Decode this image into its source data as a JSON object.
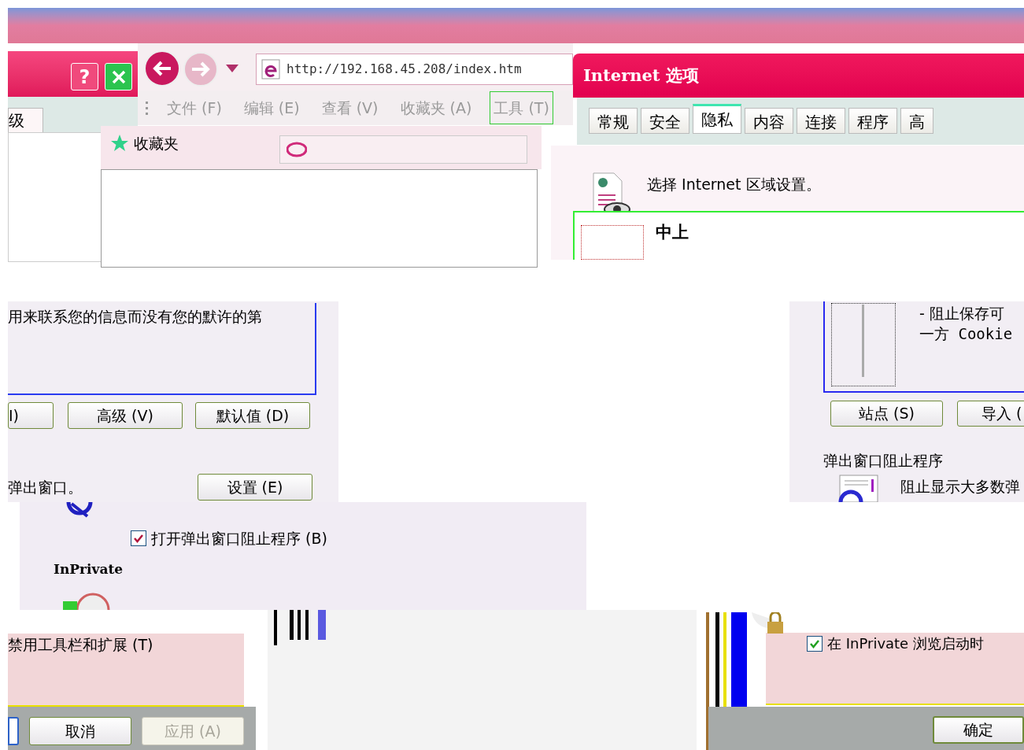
{
  "browser": {
    "address": "http://192.168.45.208/index.htm",
    "menu": [
      {
        "label": "文件 (F)",
        "selected": false
      },
      {
        "label": "编辑 (E)",
        "selected": false
      },
      {
        "label": "查看 (V)",
        "selected": false
      },
      {
        "label": "收藏夹 (A)",
        "selected": false
      },
      {
        "label": "工具 (T)",
        "selected": true
      }
    ],
    "favorites": "收藏夹"
  },
  "left_dialog": {
    "help_label": "?",
    "tab": "级",
    "text": "用来联系您的信息而没有您的默许的第",
    "buttons": [
      "I)",
      "高级 (V)",
      "默认值 (D)"
    ],
    "popup_text": "弹出窗口。",
    "settings_button": "设置 (E)",
    "popup_checkbox": {
      "label": "打开弹出窗口阻止程序 (B)",
      "checked": true
    },
    "inprivate_heading": "InPrivate",
    "toolbar_text": "禁用工具栏和扩展 (T)",
    "footer_buttons": [
      {
        "label": "取消",
        "disabled": false
      },
      {
        "label": "应用 (A)",
        "disabled": true
      }
    ]
  },
  "options_dialog": {
    "title": "Internet 选项",
    "tabs": [
      {
        "label": "常规",
        "selected": false
      },
      {
        "label": "安全",
        "selected": false
      },
      {
        "label": "隐私",
        "selected": true
      },
      {
        "label": "内容",
        "selected": false
      },
      {
        "label": "连接",
        "selected": false
      },
      {
        "label": "程序",
        "selected": false
      },
      {
        "label": "高",
        "selected": false
      }
    ],
    "zone_text": "选择 Internet 区域设置。",
    "level_name": "中上",
    "description": [
      "- 阻止保存可",
      "一方 Cookie"
    ],
    "buttons": [
      "站点 (S)",
      "导入 ("
    ],
    "popup_heading": "弹出窗口阻止程序",
    "popup_text": "阻止显示大多数弹",
    "inprivate_checkbox": {
      "label": "在 InPrivate 浏览启动时",
      "checked": true
    },
    "ok_button": "确定"
  }
}
